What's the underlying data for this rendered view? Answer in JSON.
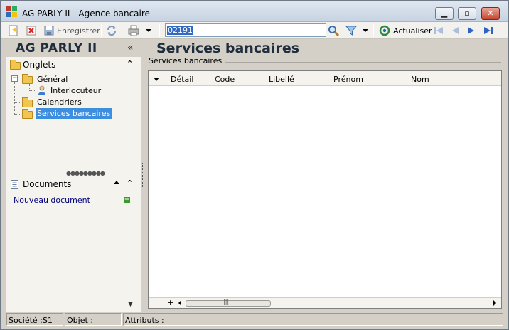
{
  "window": {
    "title": "AG PARLY II -  Agence bancaire",
    "minimize_label": "▁",
    "restore_label": "▫",
    "close_label": "✕"
  },
  "toolbar": {
    "save_label": "Enregistrer",
    "search_value": "02191",
    "refresh_label": "Actualiser"
  },
  "left_panel": {
    "header": "AG PARLY II",
    "collapse_glyph": "«",
    "tabs_section": "Onglets",
    "tree": [
      {
        "label": "Général",
        "expanded": true
      },
      {
        "label": "Interlocuteur"
      },
      {
        "label": "Calendriers"
      },
      {
        "label": "Services bancaires",
        "selected": true
      }
    ],
    "documents_section": "Documents",
    "new_document": "Nouveau document"
  },
  "main": {
    "title": "Services bancaires",
    "group_label": "Services bancaires",
    "columns": [
      "Détail",
      "Code",
      "Libellé",
      "Prénom",
      "Nom"
    ]
  },
  "status": {
    "societe": "Société :S1",
    "objet": "Objet :",
    "attributs": "Attributs :"
  },
  "colors": {
    "accent": "#3e8ee0",
    "title_text": "#1f2d3d",
    "link": "#00007a"
  }
}
